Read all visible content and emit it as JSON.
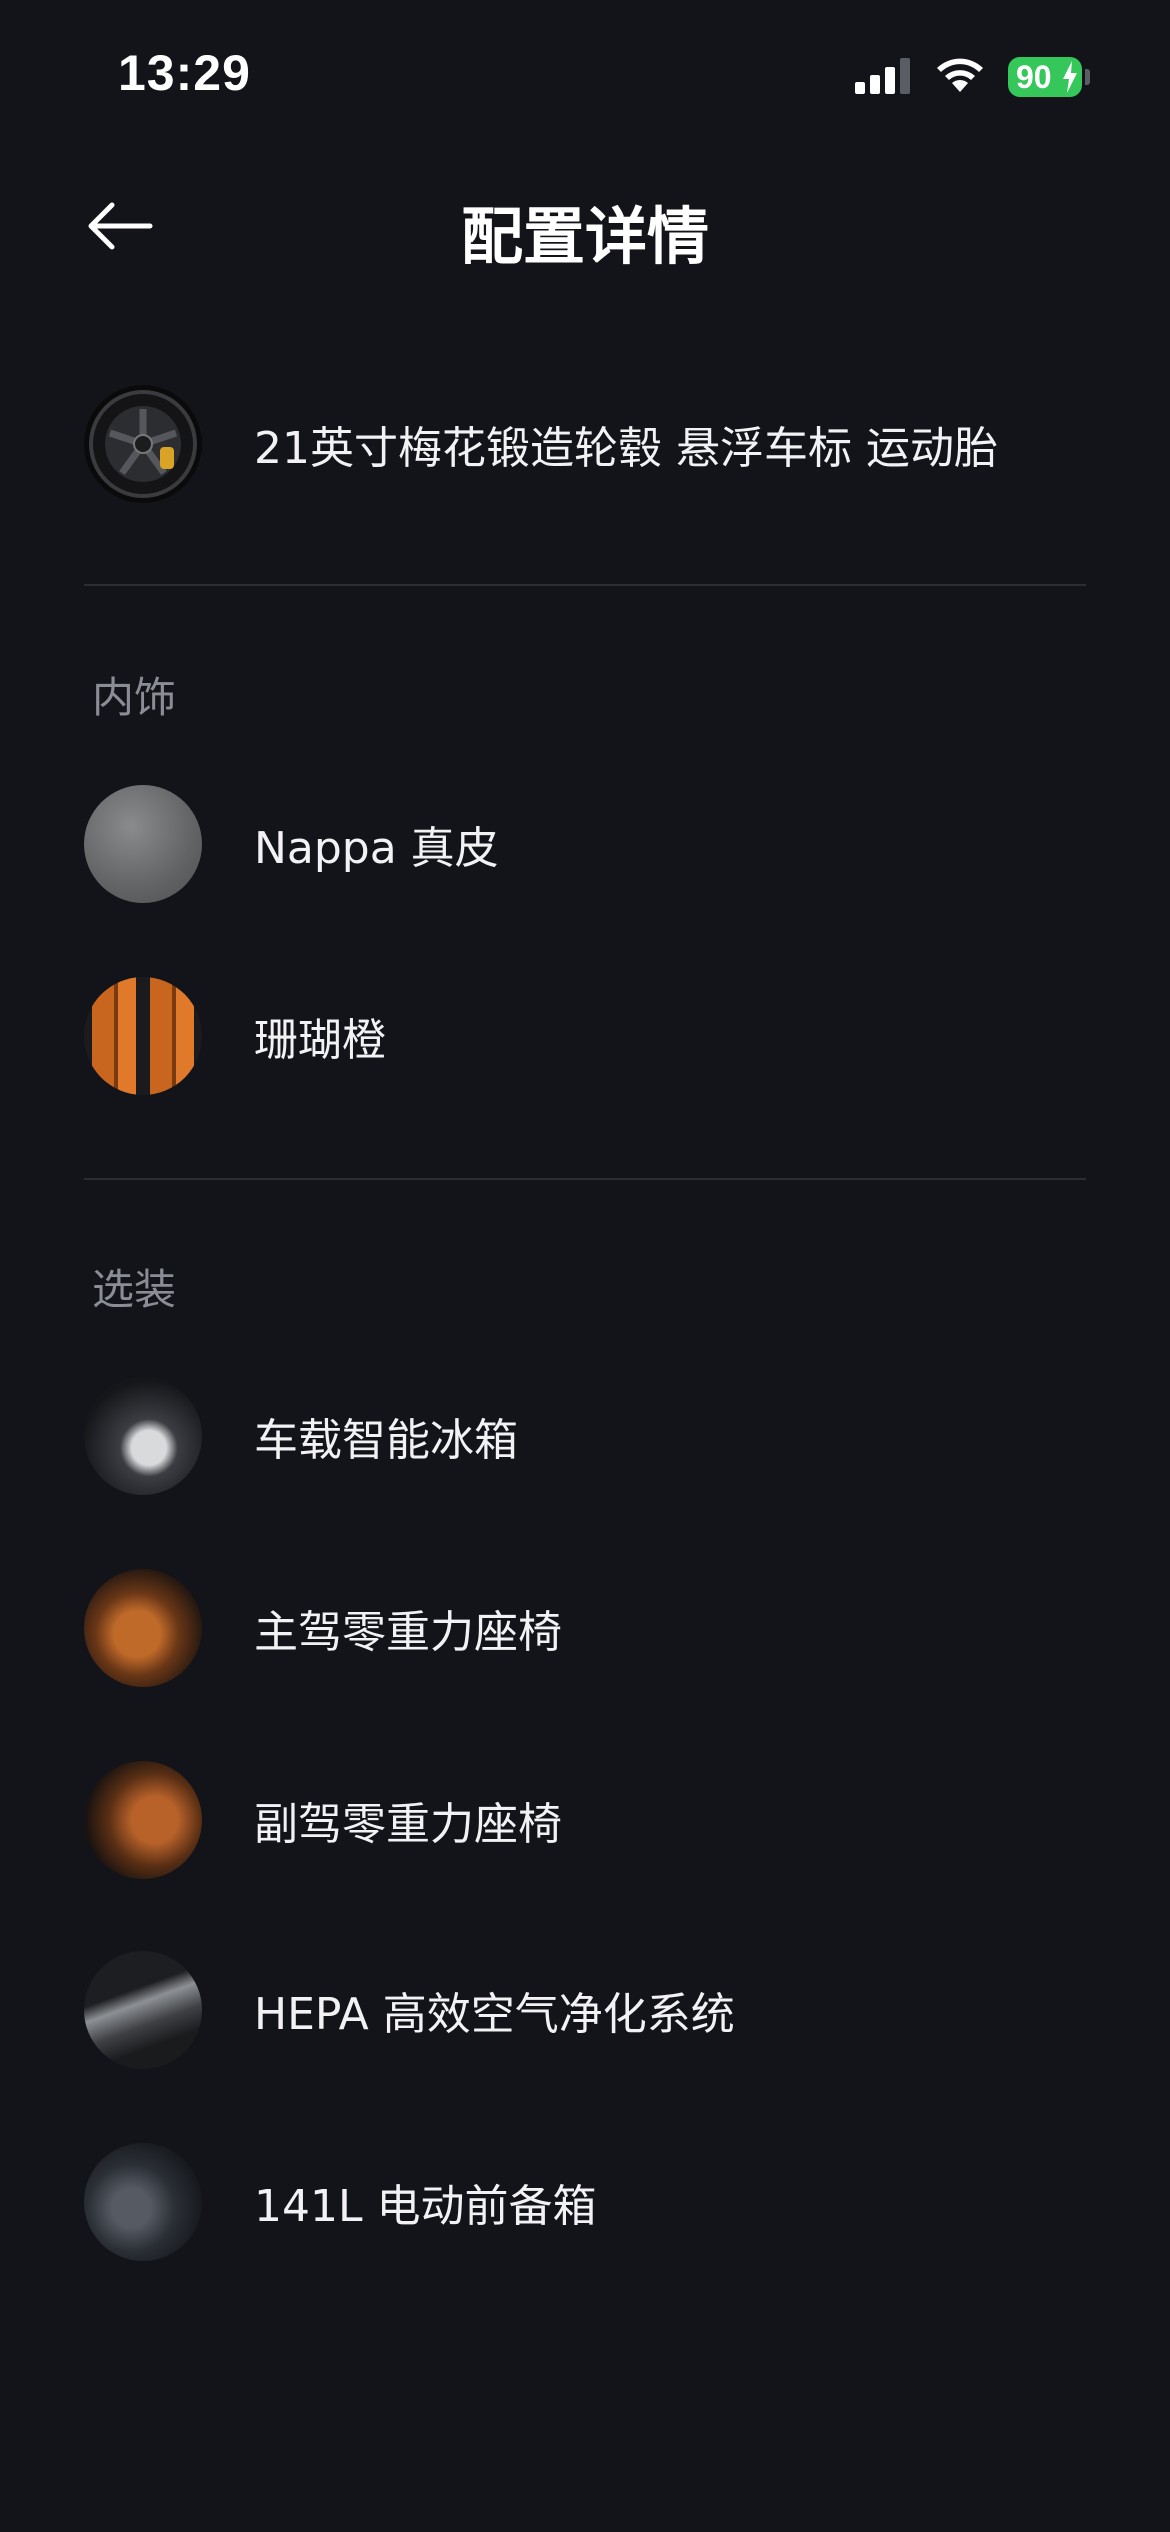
{
  "status_bar": {
    "time": "13:29",
    "battery": "90"
  },
  "nav": {
    "title": "配置详情",
    "back_icon": "arrow-left-icon"
  },
  "exterior_items": [
    {
      "label": "21英寸梅花锻造轮毂 悬浮车标 运动胎",
      "thumb": "wheel"
    }
  ],
  "sections": {
    "interior": {
      "title": "内饰",
      "items": [
        {
          "label": "Nappa 真皮",
          "thumb": "leather-grey"
        },
        {
          "label": "珊瑚橙",
          "thumb": "coral-orange"
        }
      ]
    },
    "options": {
      "title": "选装",
      "items": [
        {
          "label": "车载智能冰箱",
          "thumb": "fridge"
        },
        {
          "label": "主驾零重力座椅",
          "thumb": "driver-seat"
        },
        {
          "label": "副驾零重力座椅",
          "thumb": "passenger-seat"
        },
        {
          "label": "HEPA 高效空气净化系统",
          "thumb": "hepa-filter"
        },
        {
          "label": "141L 电动前备箱",
          "thumb": "front-trunk"
        }
      ]
    }
  },
  "colors": {
    "background": "#12141a",
    "divider": "#2a2d34",
    "section_title": "#8a8d95",
    "battery": "#35c759"
  }
}
